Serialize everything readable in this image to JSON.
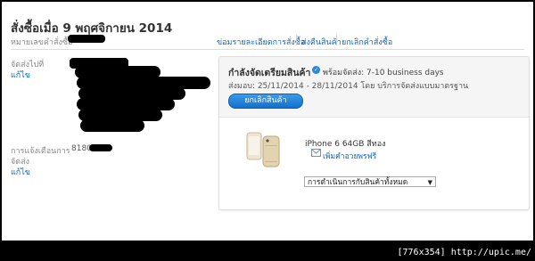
{
  "header": {
    "title": "สั่งซื้อเมื่อ 9 พฤศจิกายน 2014",
    "order_number_label": "หมายเลขคำสั่งซื้อ"
  },
  "nav_links": [
    "ข่อมรายละเอียดการสั่งซื้อ",
    "ส่งคืนสินค้า",
    "ยกเลิกคำสั่งซื้อ"
  ],
  "shipping": {
    "label": "จัดส่งไปที่",
    "edit_label": "แก้ไข"
  },
  "notification": {
    "label_line1": "การแจ้งเตือนการ",
    "label_line2": "จัดส่ง",
    "value": "8180",
    "edit_label": "แก้ไข"
  },
  "shipment": {
    "status": "กำลังจัดเตรียมสินค้า",
    "ready_text": "พร้อมจัดส่ง: 7-10 business days",
    "ship_text": "ส่งมอบ: 25/11/2014 - 28/11/2014 โดย บริการจัดส่งแบบมาตรฐาน",
    "cancel_button": "ยกเลิกสินค้า",
    "product_name": "iPhone 6 64GB สีทอง",
    "gift_link": "เพิ่มคำอวยพรฟรี",
    "actions_select": "การดำเนินการกับสินค้าทั้งหมด"
  },
  "watermark": "[776x354] http://upic.me/",
  "icons": [
    "info-check-icon",
    "gift-envelope-icon",
    "iphone-product-image",
    "select-arrow-icon"
  ],
  "colors": {
    "link": "#0a67c8",
    "button": "#1a7fd6",
    "status_dot": "#2a86d8"
  }
}
